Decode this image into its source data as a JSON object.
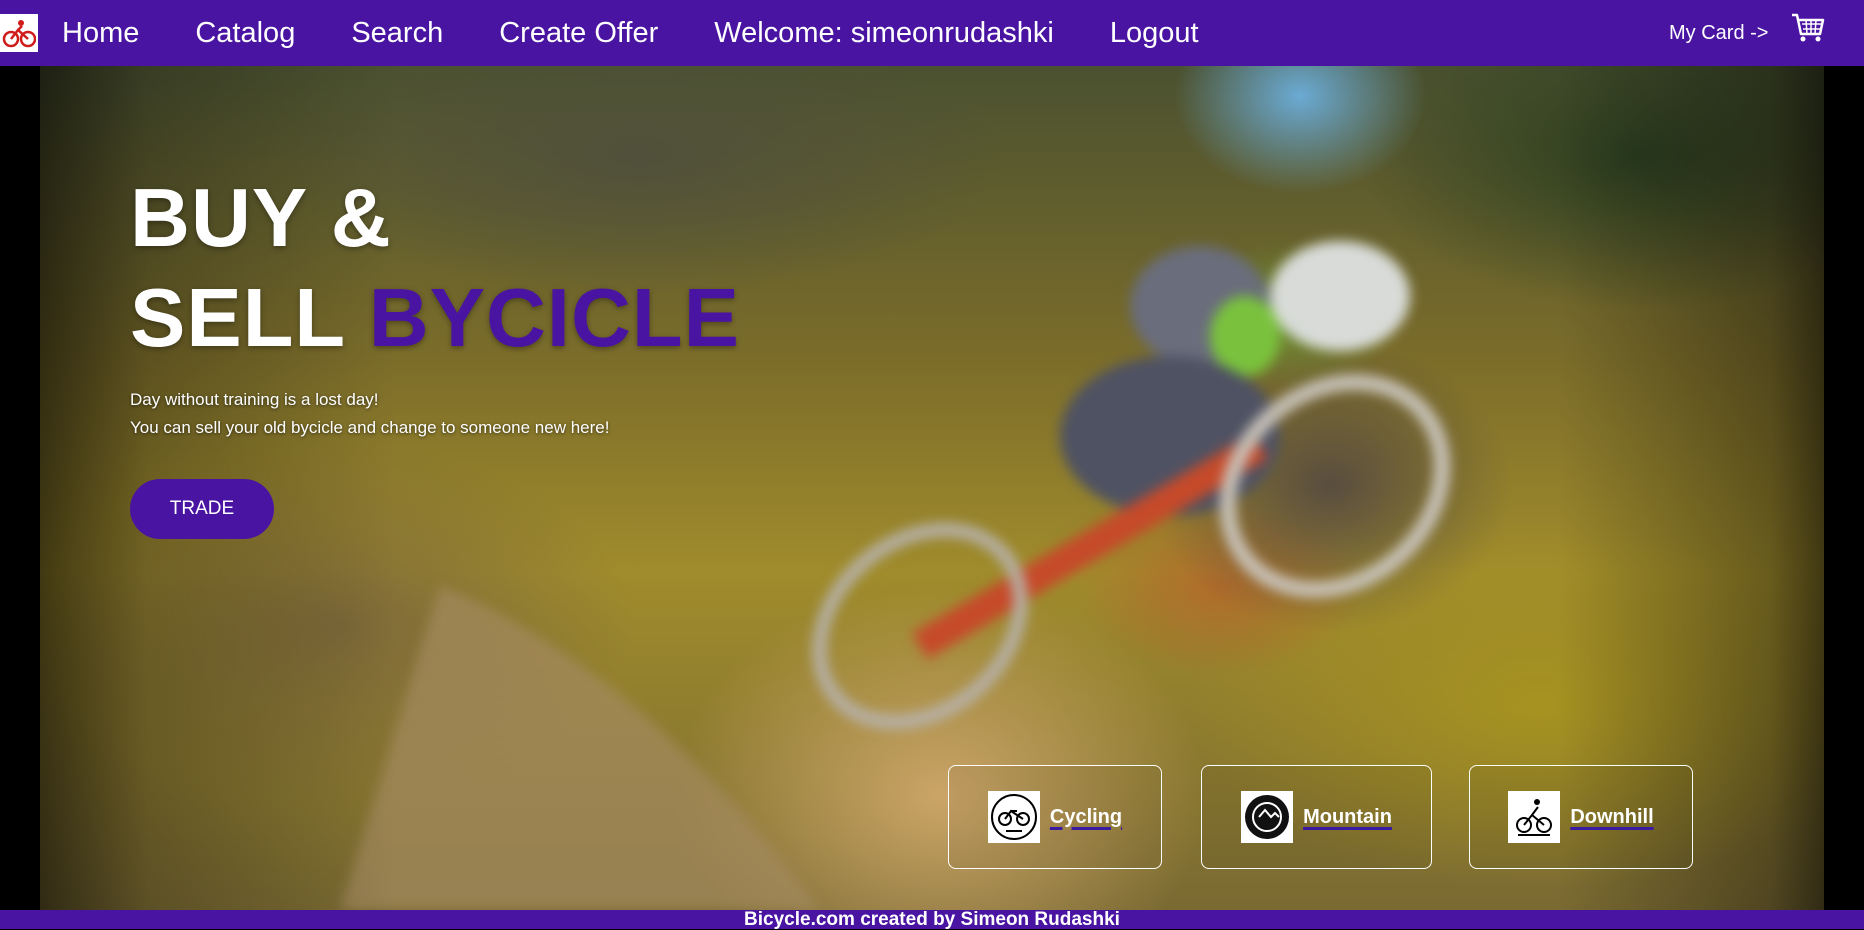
{
  "nav": {
    "links": [
      "Home",
      "Catalog",
      "Search",
      "Create Offer",
      "Welcome: simeonrudashki",
      "Logout"
    ],
    "card_label": "My Card ->"
  },
  "hero": {
    "title_line1": "BUY &",
    "title_line2_white": "SELL",
    "title_line2_accent": "BYCICLE",
    "subtitle_line1": "Day without training is a lost day!",
    "subtitle_line2": "You can sell your old bycicle and change to someone new here!",
    "trade_button": "TRADE"
  },
  "categories": [
    "Cycling",
    "Mountain",
    "Downhill"
  ],
  "footer": {
    "text": "Bicycle.com created by Simeon Rudashki"
  },
  "colors": {
    "brand": "#4a14a3"
  }
}
